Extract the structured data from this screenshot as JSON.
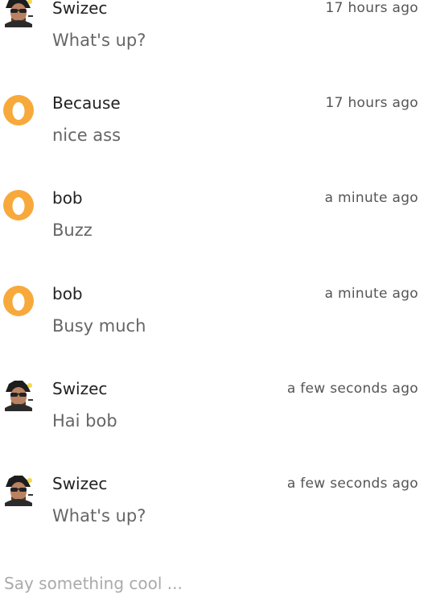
{
  "colors": {
    "egg_avatar": "#f7a93b",
    "username": "#222222",
    "message_text": "#666666",
    "timestamp": "#555555",
    "placeholder": "#aaaaaa"
  },
  "messages": [
    {
      "user": "Swizec",
      "time": "17 hours ago",
      "text": "What's up?",
      "avatar": "photo-avatar"
    },
    {
      "user": "Because",
      "time": "17 hours ago",
      "text": "nice ass",
      "avatar": "egg-avatar"
    },
    {
      "user": "bob",
      "time": "a minute ago",
      "text": "Buzz",
      "avatar": "egg-avatar"
    },
    {
      "user": "bob",
      "time": "a minute ago",
      "text": "Busy much",
      "avatar": "egg-avatar"
    },
    {
      "user": "Swizec",
      "time": "a few seconds ago",
      "text": "Hai bob",
      "avatar": "photo-avatar"
    },
    {
      "user": "Swizec",
      "time": "a few seconds ago",
      "text": "What's up?",
      "avatar": "photo-avatar"
    }
  ],
  "composer": {
    "placeholder": "Say something cool ..."
  }
}
